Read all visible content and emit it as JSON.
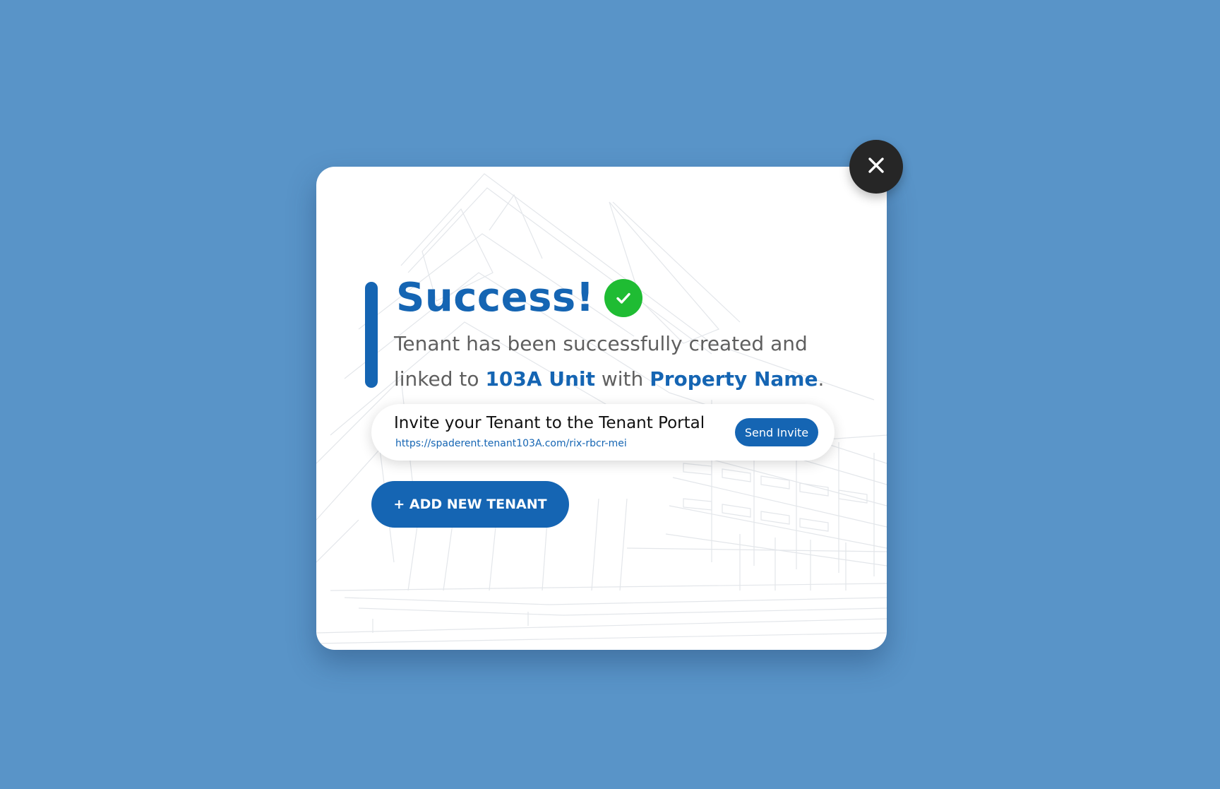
{
  "dialog": {
    "title": "Success!",
    "message": {
      "part1": "Tenant has been successfully created and linked to ",
      "unit": "103A Unit",
      "part2": " with ",
      "property": "Property Name",
      "part3": "."
    },
    "invite": {
      "title": "Invite your Tenant to the Tenant Portal",
      "link": "https://spaderent.tenant103A.com/rix-rbcr-mei",
      "button_label": "Send Invite"
    },
    "add_button_label": "+ ADD NEW TENANT"
  },
  "icons": {
    "close": "close-icon",
    "success": "checkmark-icon"
  },
  "colors": {
    "background": "#5994c8",
    "accent": "#1565b3",
    "success": "#1fbc33",
    "close_button": "#262626"
  }
}
